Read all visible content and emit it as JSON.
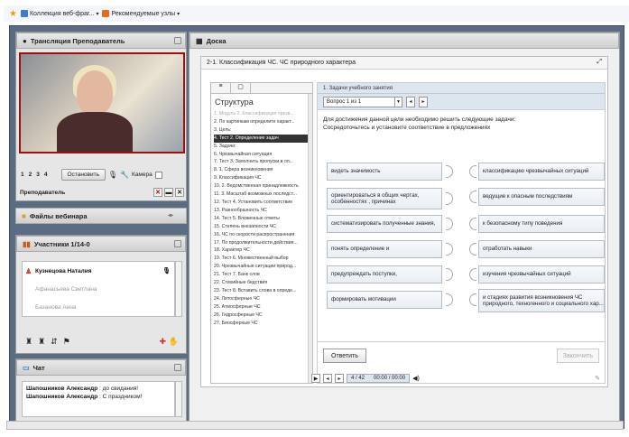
{
  "favbar": {
    "item1": "Коллекция веб-фраг...",
    "item2": "Рекомендуемые узлы"
  },
  "broadcast": {
    "title": "Трансляция Преподаватель",
    "pages": [
      "1",
      "2",
      "3",
      "4"
    ],
    "stop_label": "Остановить",
    "camera_label": "Камера",
    "teacher_label": "Преподаватель"
  },
  "files": {
    "title": "Файлы вебинара"
  },
  "participants": {
    "title": "Участники 1/14-0",
    "list": [
      "Кузнецова Наталия",
      "Афанасьева Светлана",
      "Базанова Анна"
    ]
  },
  "chat": {
    "title": "Чат",
    "messages": [
      {
        "user": "Шапошников Александр",
        "text": " : до свидания!"
      },
      {
        "user": "Шапошников Александр",
        "text": " : С праздником!"
      }
    ]
  },
  "board": {
    "title": "Доска",
    "lesson_title": "2-1. Классификация ЧС. ЧС природного характера"
  },
  "structure": {
    "title": "Структура",
    "items": [
      "1. Модуль 2. Классификация чрезв...",
      "2. По картинкам определите характ...",
      "3. Цель:",
      "4. Тест 2. Определение задач",
      "5. Задачи:",
      "6. Чрезвычайная ситуация",
      "7. Тест 3. Заполнить пропуски в оп...",
      "8. 1. Сфера возникновения",
      "9. Классификация ЧС",
      "10. 2. Ведомственная принадлежность",
      "11. 3. Масштаб возможных последст...",
      "12. Тест 4. Установить соответствие",
      "13. Разнообразность ЧС",
      "14. Тест 5. Вложенные ответы",
      "15. Степень внезапности ЧС",
      "16. ЧС по скорости распространения",
      "17. По продолжительности действия...",
      "18. Характер ЧС",
      "19. Тест 6. Множественный выбор",
      "20. Чрезвычайные ситуации природ...",
      "21. Тест 7. Банк слов",
      "22. Стихийные бедствия",
      "23. Тест 8. Вставить слова в опреде...",
      "24. Литосферные ЧС",
      "25. Атмосферные ЧС",
      "26. Гидросферные ЧС",
      "27. Биосферные ЧС"
    ]
  },
  "content": {
    "tab_label": "1. Задачи учебного занятия",
    "question_select": "Вопрос 1 из 1",
    "instruction_line1": "Для достижения данной цели необходимо решить следующие задачи:",
    "instruction_line2": "Сосредоточьтесь и установите соответствие в предложениях",
    "left_items": [
      "видеть значимость",
      "ориентироваться в общих чертах, особенностях , причинах",
      "систематизировать полученные знания,",
      "понять определение и",
      "предупреждать поступки,",
      "формировать мотивации"
    ],
    "right_items": [
      "классификацию чрезвычайных ситуаций",
      "ведущие к опасным последствиям",
      "к безопасному типу поведения",
      "отработать навыки",
      "изучения чрезвычайных ситуаций",
      "и стадиях развития возникновения ЧС природного, техногенного и социального хар..."
    ],
    "answer_label": "Ответить",
    "next_label": "Закончить"
  },
  "player": {
    "page": "4",
    "total": "/ 42",
    "time": "00:00 / 00:00"
  }
}
